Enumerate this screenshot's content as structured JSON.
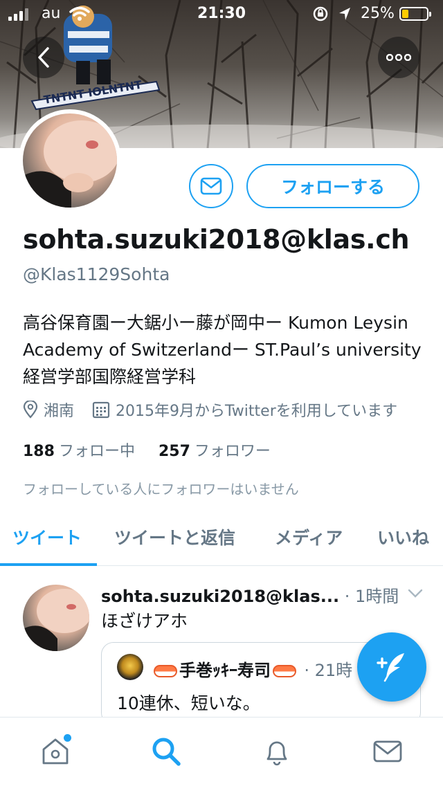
{
  "status_bar": {
    "carrier": "au",
    "time": "21:30",
    "battery_percent": "25%",
    "battery_level": 0.25,
    "battery_color": "#ffcc00"
  },
  "colors": {
    "accent": "#1da1f2",
    "text_primary": "#14171a",
    "text_secondary": "#657786"
  },
  "header": {
    "back_icon": "chevron-left-icon",
    "more_icon": "ellipsis-icon"
  },
  "profile": {
    "display_name": "sohta.suzuki2018@klas.ch",
    "handle": "@Klas1129Sohta",
    "follow_label": "フォローする",
    "bio": "高谷保育園ー大鋸小ー藤が岡中ー Kumon Leysin Academy of Switzerlandー ST.Paul’s university 経営学部国際経営学科",
    "location": "湘南",
    "joined": "2015年9月からTwitterを利用しています",
    "following_count": "188",
    "following_label": "フォロー中",
    "followers_count": "257",
    "followers_label": "フォロワー",
    "no_known_followers": "フォローしている人にフォロワーはいません"
  },
  "tabs": [
    {
      "label": "ツイート",
      "active": true
    },
    {
      "label": "ツイートと返信",
      "active": false
    },
    {
      "label": "メディア",
      "active": false
    },
    {
      "label": "いいね",
      "active": false
    }
  ],
  "tweet": {
    "name": "sohta.suzuki2018@klas...",
    "time": "· 1時間",
    "text": "ほざけアホ",
    "quote": {
      "name": "手巻ｯｷｰ寿司",
      "time": "· 21時",
      "text": "10連休、短いな。"
    }
  },
  "bottom_nav": [
    "home-icon",
    "search-icon",
    "notifications-icon",
    "messages-icon"
  ]
}
